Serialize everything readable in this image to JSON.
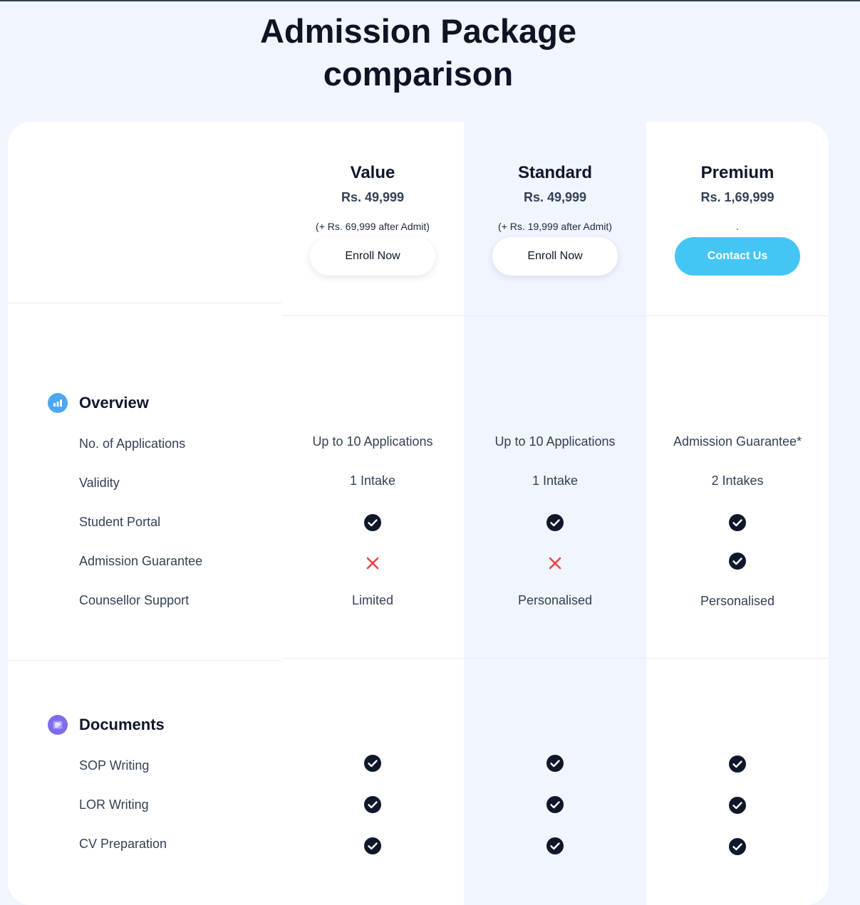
{
  "page": {
    "title_line1": "Admission Package",
    "title_line2": "comparison"
  },
  "plans": [
    {
      "name": "Value",
      "price": "Rs. 49,999",
      "note": "(+ Rs. 69,999 after Admit)",
      "button": "Enroll Now"
    },
    {
      "name": "Standard",
      "price": "Rs. 49,999",
      "note": "(+ Rs. 19,999 after Admit)",
      "button": "Enroll Now"
    },
    {
      "name": "Premium",
      "price": "Rs. 1,69,999",
      "note": ".",
      "button": "Contact Us"
    }
  ],
  "sections": [
    {
      "title": "Overview",
      "icon": "bar-chart-icon",
      "rows": [
        {
          "label": "No. of Applications",
          "values": [
            "Up to 10 Applications",
            "Up to 10 Applications",
            "Admission Guarantee*"
          ]
        },
        {
          "label": "Validity",
          "values": [
            "1 Intake",
            "1 Intake",
            "2 Intakes"
          ]
        },
        {
          "label": "Student Portal",
          "values": [
            "check",
            "check",
            "check"
          ]
        },
        {
          "label": "Admission Guarantee",
          "values": [
            "cross",
            "cross",
            "check"
          ]
        },
        {
          "label": "Counsellor Support",
          "values": [
            "Limited",
            "Personalised",
            "Personalised"
          ]
        }
      ]
    },
    {
      "title": "Documents",
      "icon": "document-icon",
      "rows": [
        {
          "label": "SOP Writing",
          "values": [
            "check",
            "check",
            "check"
          ]
        },
        {
          "label": "LOR Writing",
          "values": [
            "check",
            "check",
            "check"
          ]
        },
        {
          "label": "CV Preparation",
          "values": [
            "check",
            "check",
            "check"
          ]
        }
      ]
    }
  ],
  "colors": {
    "page_bg": "#f0f5fe",
    "accent_blue": "#43c6f5",
    "check": "#0f172a",
    "cross": "#ef4444",
    "overview_icon": "#4aa8f5",
    "documents_icon": "#7c6cf0"
  }
}
